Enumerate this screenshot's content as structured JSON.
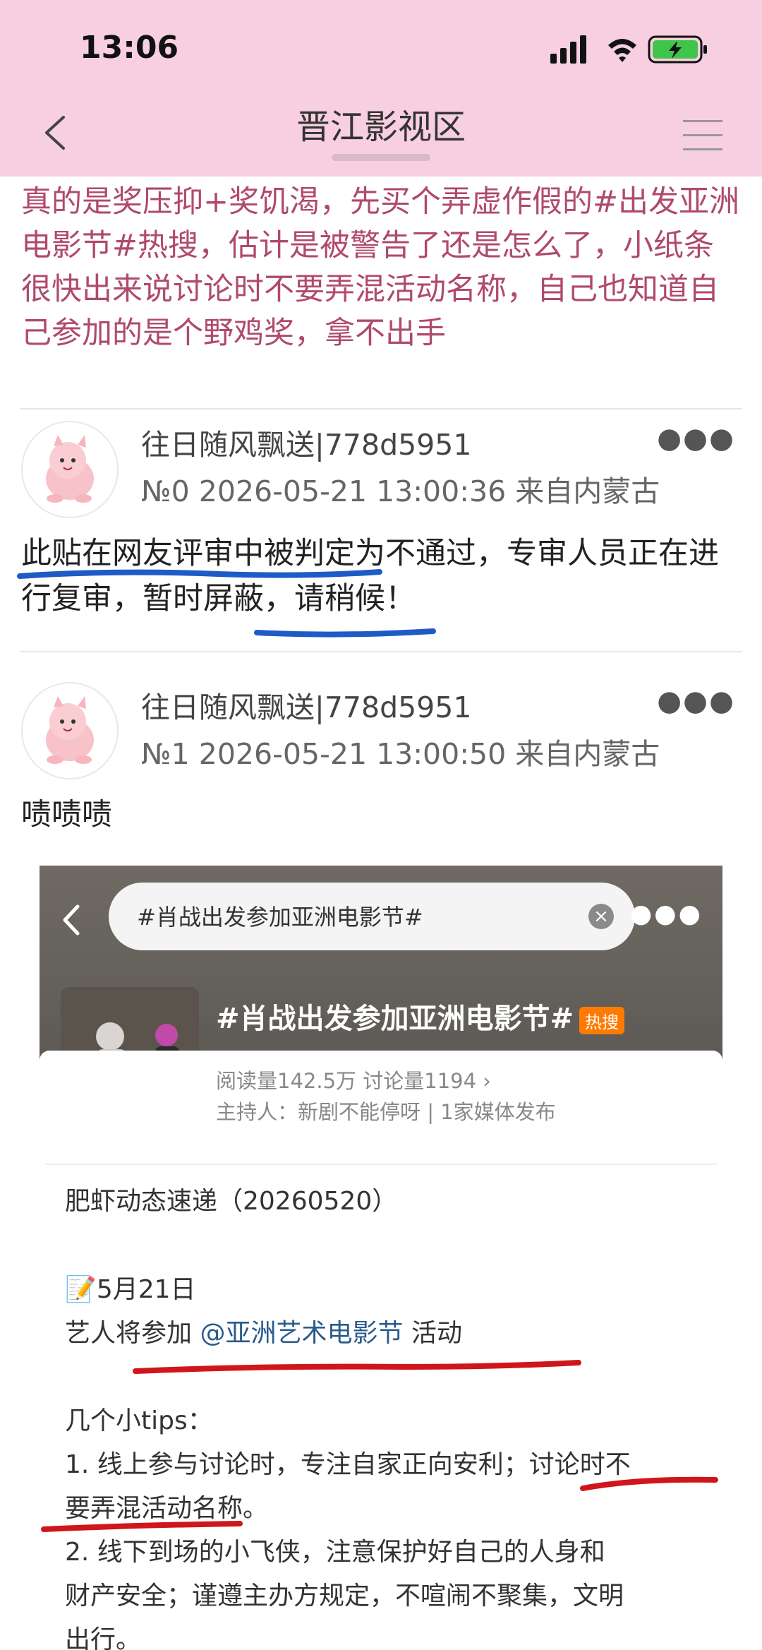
{
  "status": {
    "time": "13:06"
  },
  "nav": {
    "title": "晋江影视区"
  },
  "post": {
    "text": "真的是奖压抑+奖饥渴，先买个弄虚作假的#出发亚洲电影节#热搜，估计是被警告了还是怎么了，小纸条很快出来说讨论时不要弄混活动名称，自己也知道自己参加的是个野鸡奖，拿不出手"
  },
  "replies": [
    {
      "username": "往日随风飘送|778d5951",
      "meta": "№0  2026-05-21 13:00:36 来自内蒙古",
      "text": "此贴在网友评审中被判定为不通过，专审人员正在进行复审，暂时屏蔽，请稍候！"
    },
    {
      "username": "往日随风飘送|778d5951",
      "meta": "№1  2026-05-21 13:00:50 来自内蒙古",
      "text": "啧啧啧"
    }
  ],
  "embed": {
    "search_text": "#肖战出发参加亚洲电影节#",
    "topic_title": "#肖战出发参加亚洲电影节#",
    "hot_badge": "热搜",
    "stats": "阅读量142.5万  讨论量1194  ›",
    "host": "主持人：新剧不能停呀 | 1家媒体发布",
    "lines": {
      "l1": "肥虾动态速递（20260520）",
      "l2": "📝5月21日",
      "l3a": "艺人将参加",
      "l3b": "@亚洲艺术电影节",
      "l3c": "活动",
      "l4": "几个小tips：",
      "l5": "1. 线上参与讨论时，专注自家正向安利；讨论时不",
      "l6": "要弄混活动名称。",
      "l7": "2. 线下到场的小飞侠，注意保护好自己的人身和",
      "l8": "财产安全；谨遵主办方规定，不喧闹不聚集，文明",
      "l9": "出行。"
    }
  },
  "colors": {
    "header_bg": "#f8cfe0",
    "post_text": "#b04a6a",
    "blue_underline": "#1e5bc6",
    "red_underline": "#d0161c"
  }
}
